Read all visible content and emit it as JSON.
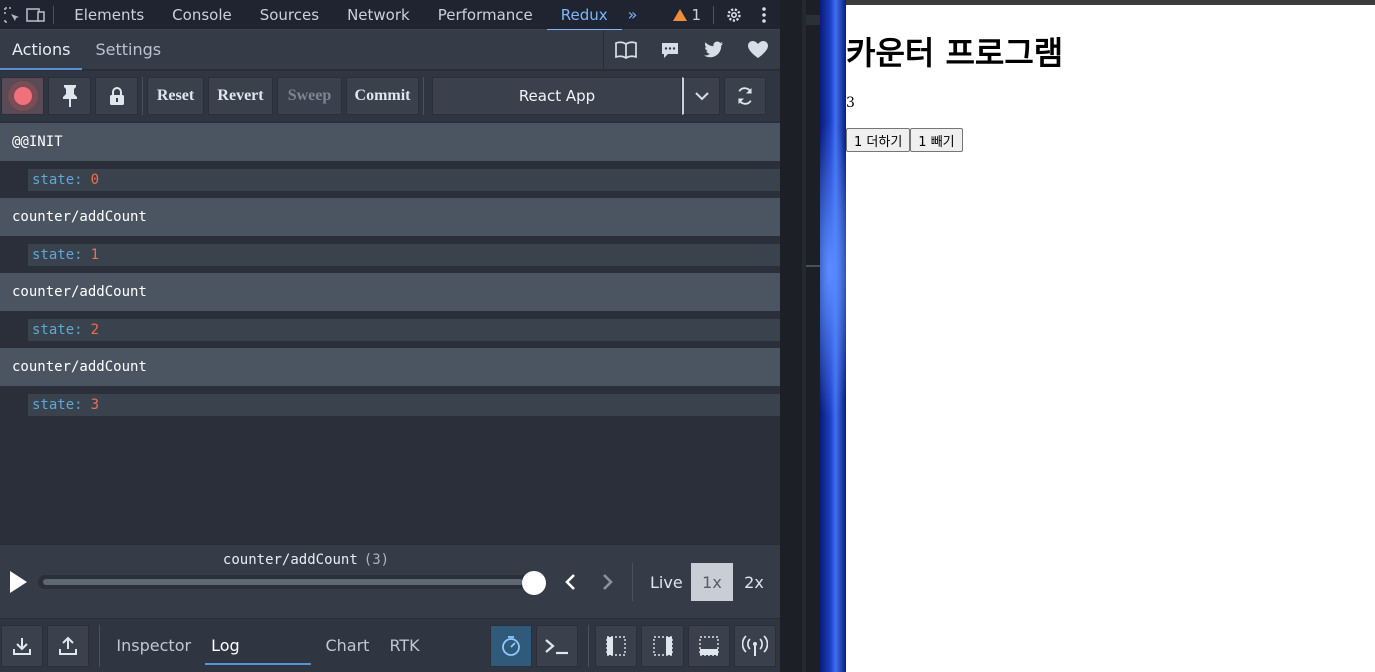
{
  "devtools": {
    "tabs": [
      {
        "label": "Elements"
      },
      {
        "label": "Console"
      },
      {
        "label": "Sources"
      },
      {
        "label": "Network"
      },
      {
        "label": "Performance"
      },
      {
        "label": "Redux"
      }
    ],
    "more_label": "»",
    "warning_count": "1"
  },
  "redux": {
    "sub_tabs": [
      {
        "label": "Actions"
      },
      {
        "label": "Settings"
      }
    ],
    "toolbar": {
      "reset": "Reset",
      "revert": "Revert",
      "sweep": "Sweep",
      "commit": "Commit",
      "instance": "React App"
    },
    "log": [
      {
        "action": "@@INIT",
        "state_key": "state:",
        "state_value": "0"
      },
      {
        "action": "counter/addCount",
        "state_key": "state:",
        "state_value": "1"
      },
      {
        "action": "counter/addCount",
        "state_key": "state:",
        "state_value": "2"
      },
      {
        "action": "counter/addCount",
        "state_key": "state:",
        "state_value": "3"
      }
    ],
    "slider": {
      "current_action": "counter/addCount",
      "current_index": "(3)",
      "progress": 1.0,
      "live": "Live",
      "speed_1x": "1x",
      "speed_2x": "2x"
    },
    "monitors": [
      {
        "label": "Inspector"
      },
      {
        "label": "Log monitor"
      },
      {
        "label": "Chart"
      },
      {
        "label": "RTK Query"
      }
    ]
  },
  "page": {
    "title": "카운터 프로그램",
    "count": "3",
    "add_button": "1 더하기",
    "sub_button": "1 빼기"
  },
  "colors": {
    "accent": "#7cb7ff",
    "state_key": "#5aa9d6",
    "state_value": "#ef6f4a",
    "action_row": "#4b5562"
  }
}
